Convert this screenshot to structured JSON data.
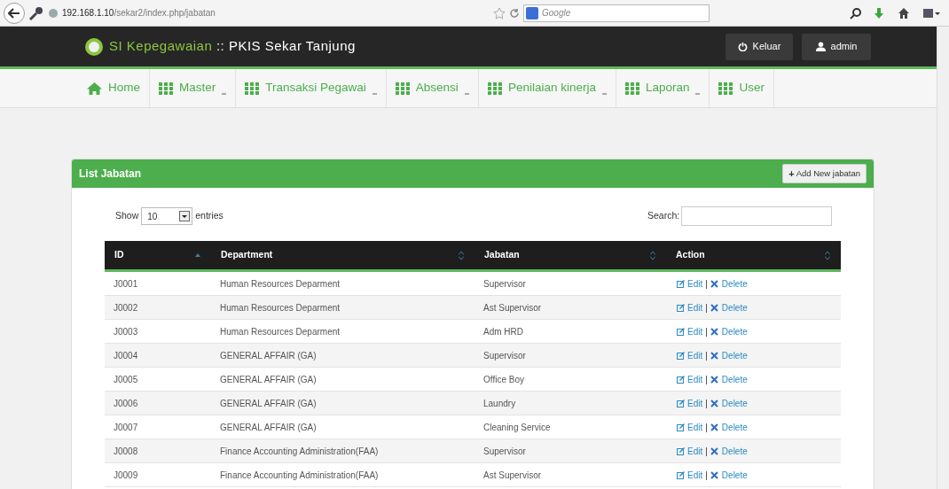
{
  "browser": {
    "url_host": "192.168.1.10",
    "url_path": "/sekar2/index.php/jabatan",
    "search_placeholder": "Google"
  },
  "header": {
    "brand_accent": "SI Kepegawaian",
    "brand_rest": " :: PKIS Sekar Tanjung",
    "buttons": [
      "Keluar",
      "admin"
    ]
  },
  "nav": [
    {
      "label": "Home",
      "kind": "home",
      "dropdown": false
    },
    {
      "label": "Master",
      "kind": "grid",
      "dropdown": true
    },
    {
      "label": "Transaksi Pegawai",
      "kind": "grid",
      "dropdown": true
    },
    {
      "label": "Absensi",
      "kind": "grid",
      "dropdown": true
    },
    {
      "label": "Penilaian kinerja",
      "kind": "grid",
      "dropdown": true
    },
    {
      "label": "Laporan",
      "kind": "grid",
      "dropdown": true
    },
    {
      "label": "User",
      "kind": "grid",
      "dropdown": false
    }
  ],
  "panel": {
    "title": "List Jabatan",
    "add_icon": "+",
    "add_button": "Add New jabatan"
  },
  "length_control": {
    "prefix": "Show",
    "value": "10",
    "suffix": "entries"
  },
  "search": {
    "label": "Search:"
  },
  "table": {
    "columns": [
      {
        "label": "ID",
        "sorted": true
      },
      {
        "label": "Department",
        "sorted": false
      },
      {
        "label": "Jabatan",
        "sorted": false
      },
      {
        "label": "Action",
        "sorted": false
      }
    ],
    "rows": [
      {
        "cells": [
          "J0001",
          "Human Resources Deparment",
          "Supervisor"
        ],
        "edit": "Edit",
        "separator": "|",
        "delete": "Delete"
      },
      {
        "cells": [
          "J0002",
          "Human Resources Deparment",
          "Ast Supervisor"
        ],
        "edit": "Edit",
        "separator": "|",
        "delete": "Delete"
      },
      {
        "cells": [
          "J0003",
          "Human Resources Deparment",
          "Adm HRD"
        ],
        "edit": "Edit",
        "separator": "|",
        "delete": "Delete"
      },
      {
        "cells": [
          "J0004",
          "GENERAL AFFAIR (GA)",
          "Supervisor"
        ],
        "edit": "Edit",
        "separator": "|",
        "delete": "Delete"
      },
      {
        "cells": [
          "J0005",
          "GENERAL AFFAIR (GA)",
          "Office Boy"
        ],
        "edit": "Edit",
        "separator": "|",
        "delete": "Delete"
      },
      {
        "cells": [
          "J0006",
          "GENERAL AFFAIR (GA)",
          "Laundry"
        ],
        "edit": "Edit",
        "separator": "|",
        "delete": "Delete"
      },
      {
        "cells": [
          "J0007",
          "GENERAL AFFAIR (GA)",
          "Cleaning Service"
        ],
        "edit": "Edit",
        "separator": "|",
        "delete": "Delete"
      },
      {
        "cells": [
          "J0008",
          "Finance Accounting Administration(FAA)",
          "Supervisor"
        ],
        "edit": "Edit",
        "separator": "|",
        "delete": "Delete"
      },
      {
        "cells": [
          "J0009",
          "Finance Accounting Administration(FAA)",
          "Ast Supervisor"
        ],
        "edit": "Edit",
        "separator": "|",
        "delete": "Delete"
      }
    ]
  }
}
